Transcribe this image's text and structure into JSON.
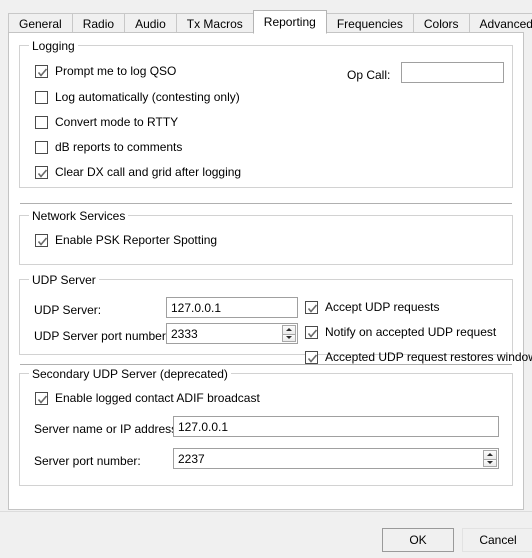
{
  "tabs": [
    {
      "label": "General",
      "active": false
    },
    {
      "label": "Radio",
      "active": false
    },
    {
      "label": "Audio",
      "active": false
    },
    {
      "label": "Tx Macros",
      "active": false
    },
    {
      "label": "Reporting",
      "active": true
    },
    {
      "label": "Frequencies",
      "active": false
    },
    {
      "label": "Colors",
      "active": false
    },
    {
      "label": "Advanced",
      "active": false
    }
  ],
  "logging": {
    "title": "Logging",
    "checkboxes": [
      {
        "label": "Prompt me to log QSO",
        "checked": true
      },
      {
        "label": "Log automatically (contesting only)",
        "checked": false
      },
      {
        "label": "Convert mode to RTTY",
        "checked": false
      },
      {
        "label": "dB reports to comments",
        "checked": false
      },
      {
        "label": "Clear DX call and grid after logging",
        "checked": true
      }
    ],
    "op_call_label": "Op Call:",
    "op_call_value": "",
    "op_call_placeholder": ""
  },
  "network_services": {
    "title": "Network Services",
    "checkboxes": [
      {
        "label": "Enable PSK Reporter Spotting",
        "checked": true
      }
    ]
  },
  "udp_server": {
    "title": "UDP Server",
    "server_label": "UDP Server:",
    "server_value": "127.0.0.1",
    "port_label": "UDP Server port number:",
    "port_value": "2333",
    "checkboxes": [
      {
        "label": "Accept UDP requests",
        "checked": true
      },
      {
        "label": "Notify on accepted UDP request",
        "checked": true
      },
      {
        "label": "Accepted UDP request restores window",
        "checked": true
      }
    ]
  },
  "secondary_udp_server": {
    "title": "Secondary UDP Server (deprecated)",
    "checkboxes": [
      {
        "label": "Enable logged contact ADIF broadcast",
        "checked": true
      }
    ],
    "server_label": "Server name or IP address:",
    "server_value": "127.0.0.1",
    "port_label": "Server port number:",
    "port_value": "2237"
  },
  "buttons": {
    "ok": "OK",
    "cancel": "Cancel"
  },
  "colors": {
    "window_bg": "#f0f0f0",
    "panel_bg": "#ffffff",
    "group_border": "#d2d2d2",
    "field_border": "#a0a0a0",
    "text": "#000000"
  }
}
